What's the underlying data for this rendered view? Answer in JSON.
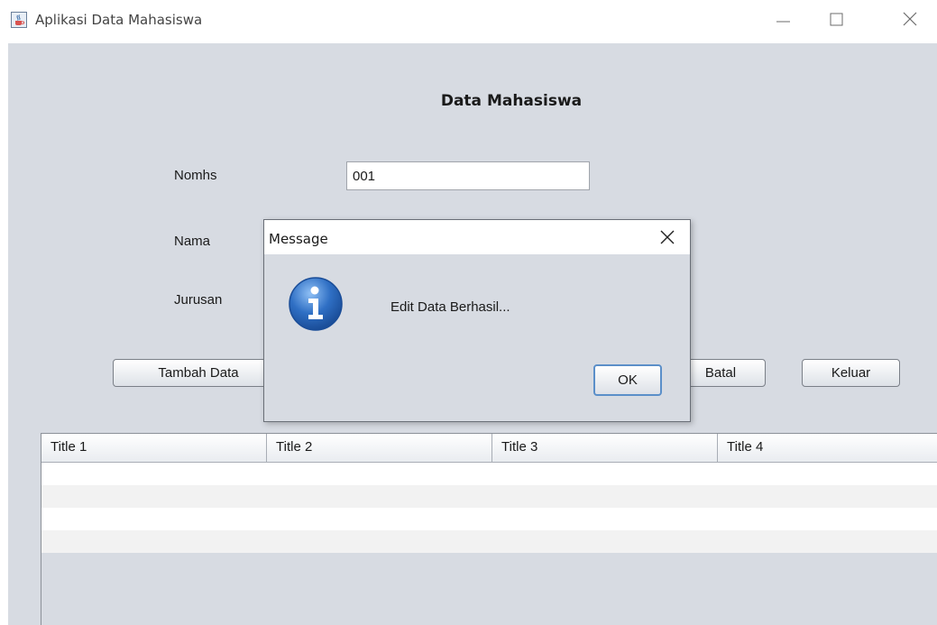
{
  "window": {
    "title": "Aplikasi Data Mahasiswa",
    "icon": "java-cup-icon"
  },
  "form": {
    "heading": "Data Mahasiswa",
    "fields": [
      {
        "label": "Nomhs",
        "value": "001"
      },
      {
        "label": "Nama",
        "value": ""
      },
      {
        "label": "Jurusan",
        "value": ""
      }
    ]
  },
  "buttons": {
    "tambah": "Tambah Data",
    "batal": "Batal",
    "keluar": "Keluar"
  },
  "table": {
    "columns": [
      "Title 1",
      "Title 2",
      "Title 3",
      "Title 4"
    ],
    "rows": 4
  },
  "dialog": {
    "title": "Message",
    "message": "Edit Data Berhasil...",
    "ok_label": "OK",
    "icon": "information-icon"
  },
  "colors": {
    "panel": "#d7dbe2",
    "info_icon": "#2f6fc4",
    "focus_border": "#5b8fc9"
  }
}
